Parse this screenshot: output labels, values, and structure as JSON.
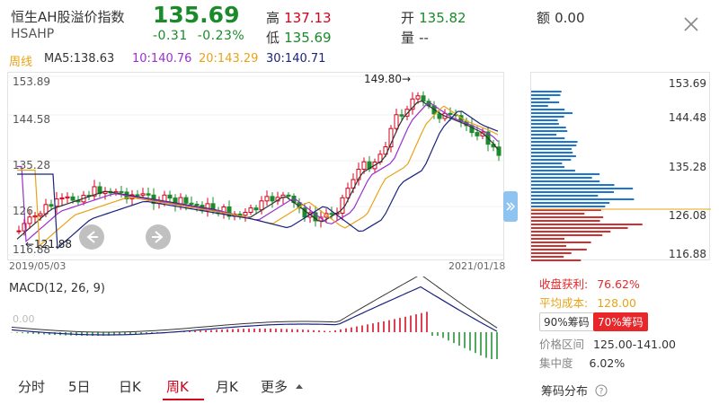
{
  "header": {
    "name": "恒生AH股溢价指数",
    "code": "HSAHP",
    "price": "135.69",
    "change": "-0.31",
    "change_pct": "-0.23%",
    "high_label": "高",
    "high": "137.13",
    "low_label": "低",
    "low": "135.69",
    "open_label": "开",
    "open": "135.82",
    "volume_label": "量",
    "volume": "--",
    "amount_label": "额",
    "amount": "0.00"
  },
  "ma": {
    "period": "周线",
    "ma5": "MA5:138.63",
    "ma10": "10:140.76",
    "ma20": "20:143.29",
    "ma30": "30:140.71",
    "colors": {
      "ma5": "#333333",
      "ma10": "#9b2fcf",
      "ma20": "#e8a317",
      "ma30": "#1a237e"
    }
  },
  "kline": {
    "y_labels": [
      "153.89",
      "144.58",
      "135.28",
      "126",
      "116.88"
    ],
    "date_start": "2019/05/03",
    "date_end": "2021/01/18",
    "max_annot": "149.80→",
    "min_annot": "←121.88"
  },
  "macd": {
    "label": "MACD(12, 26, 9)",
    "zero_label": "0.00"
  },
  "chips": {
    "y_labels": [
      "153.69",
      "144.48",
      "135.28",
      "126.08",
      "116.88"
    ],
    "profit_label": "收盘获利:",
    "profit": "76.62%",
    "cost_label": "平均成本:",
    "cost": "128.00",
    "btn90": "90%筹码",
    "btn70": "70%筹码",
    "range_label": "价格区间",
    "range": "125.00-141.00",
    "conc_label": "集中度",
    "conc": "6.02%",
    "dist_label": "筹码分布"
  },
  "tabs": [
    "分时",
    "5日",
    "日K",
    "周K",
    "月K",
    "更多"
  ]
}
